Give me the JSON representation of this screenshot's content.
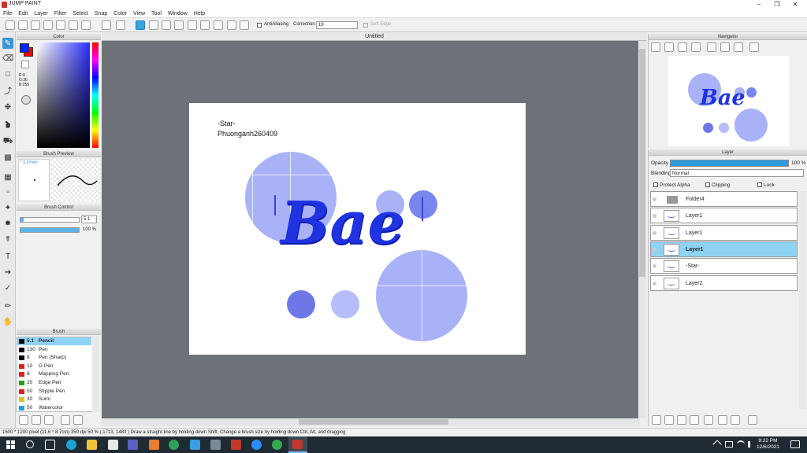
{
  "app": {
    "title": "JUMP PAINT"
  },
  "menu": [
    "File",
    "Edit",
    "Layer",
    "Filter",
    "Select",
    "Snap",
    "Color",
    "View",
    "Tool",
    "Window",
    "Help"
  ],
  "toolbar": {
    "antialias_label": "AntiAliasing",
    "correction_label": "Correction",
    "correction_value": "19",
    "softedge_label": "Soft Edge"
  },
  "panels": {
    "color": "Color",
    "brush_preview": "Brush Preview",
    "brush_control": "Brush Control",
    "brush": "Brush",
    "navigator": "Navigator",
    "layer": "Layer"
  },
  "color": {
    "r": "R:0",
    "g": "G:36",
    "b": "B:255",
    "fg": "#0024ff",
    "bg": "#ff0000"
  },
  "brush_preview": {
    "size": "* 0.37mm"
  },
  "brush_control": {
    "size_value": "5.1",
    "opacity_value": "100 %"
  },
  "brushes": [
    {
      "size": "5.1",
      "name": "Pencil",
      "color": "#000000",
      "selected": true
    },
    {
      "size": "130",
      "name": "Pen",
      "color": "#000000",
      "selected": false
    },
    {
      "size": "8",
      "name": "Pen (Sharp)",
      "color": "#000000",
      "selected": false
    },
    {
      "size": "10",
      "name": "G Pen",
      "color": "#e02020",
      "selected": false
    },
    {
      "size": "8",
      "name": "Mapping Pen",
      "color": "#e02020",
      "selected": false
    },
    {
      "size": "20",
      "name": "Edge Pen",
      "color": "#20a020",
      "selected": false
    },
    {
      "size": "50",
      "name": "Stipple Pen",
      "color": "#e02020",
      "selected": false
    },
    {
      "size": "30",
      "name": "Sumi",
      "color": "#e0c020",
      "selected": false
    },
    {
      "size": "50",
      "name": "Watercolor",
      "color": "#20a0e0",
      "selected": false
    }
  ],
  "document": {
    "tab": "Untitled",
    "text_line1": "-Star-",
    "text_line2": "Phuonganh260409",
    "art_text": "Bae"
  },
  "layer_panel": {
    "opacity_label": "Opacity",
    "opacity_value": "100 %",
    "opacity_fraction": 1.0,
    "blending_label": "Blending",
    "blending_value": "Normal",
    "protect_alpha": "Protect Alpha",
    "clipping": "Clipping",
    "lock": "Lock"
  },
  "layers": [
    {
      "name": "Folder4",
      "selected": false,
      "icon": "folder-icon"
    },
    {
      "name": "Layer1",
      "selected": false,
      "icon": "layer-thumb"
    },
    {
      "name": "Layer1",
      "selected": false,
      "icon": "layer-thumb"
    },
    {
      "name": "Layer1",
      "selected": true,
      "icon": "layer-thumb"
    },
    {
      "name": "-Star-",
      "selected": false,
      "icon": "text-layer-thumb"
    },
    {
      "name": "Layer2",
      "selected": false,
      "icon": "layer-thumb"
    }
  ],
  "status": {
    "text": "1600 * 1200 pixel   (11.6 * 8.7cm)   350 dpi   50 %   ( 1713, 1480 )   Draw a straight line by holding down Shift, Change a brush size by holding down Ctrl, Alt, and dragging"
  },
  "taskbar": {
    "time": "9:22 PM",
    "date": "12/6/2021",
    "lang": "ENG"
  }
}
